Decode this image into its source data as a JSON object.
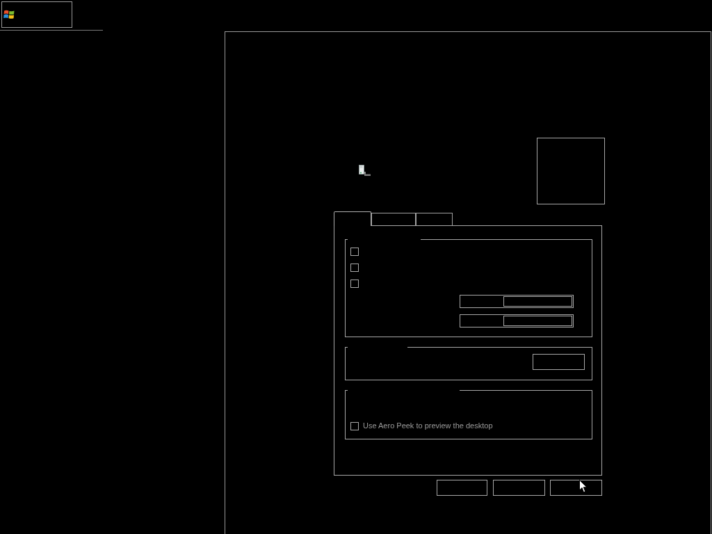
{
  "dialog": {
    "tabs": [
      {
        "selected": true
      },
      {
        "selected": false
      },
      {
        "selected": false
      }
    ],
    "group_1": {
      "checkboxes": [
        {
          "checked": false
        },
        {
          "checked": false
        },
        {
          "checked": false
        }
      ]
    },
    "group_3": {
      "aero_peek": {
        "label": "Use Aero Peek to preview the desktop",
        "checked": false
      }
    }
  }
}
